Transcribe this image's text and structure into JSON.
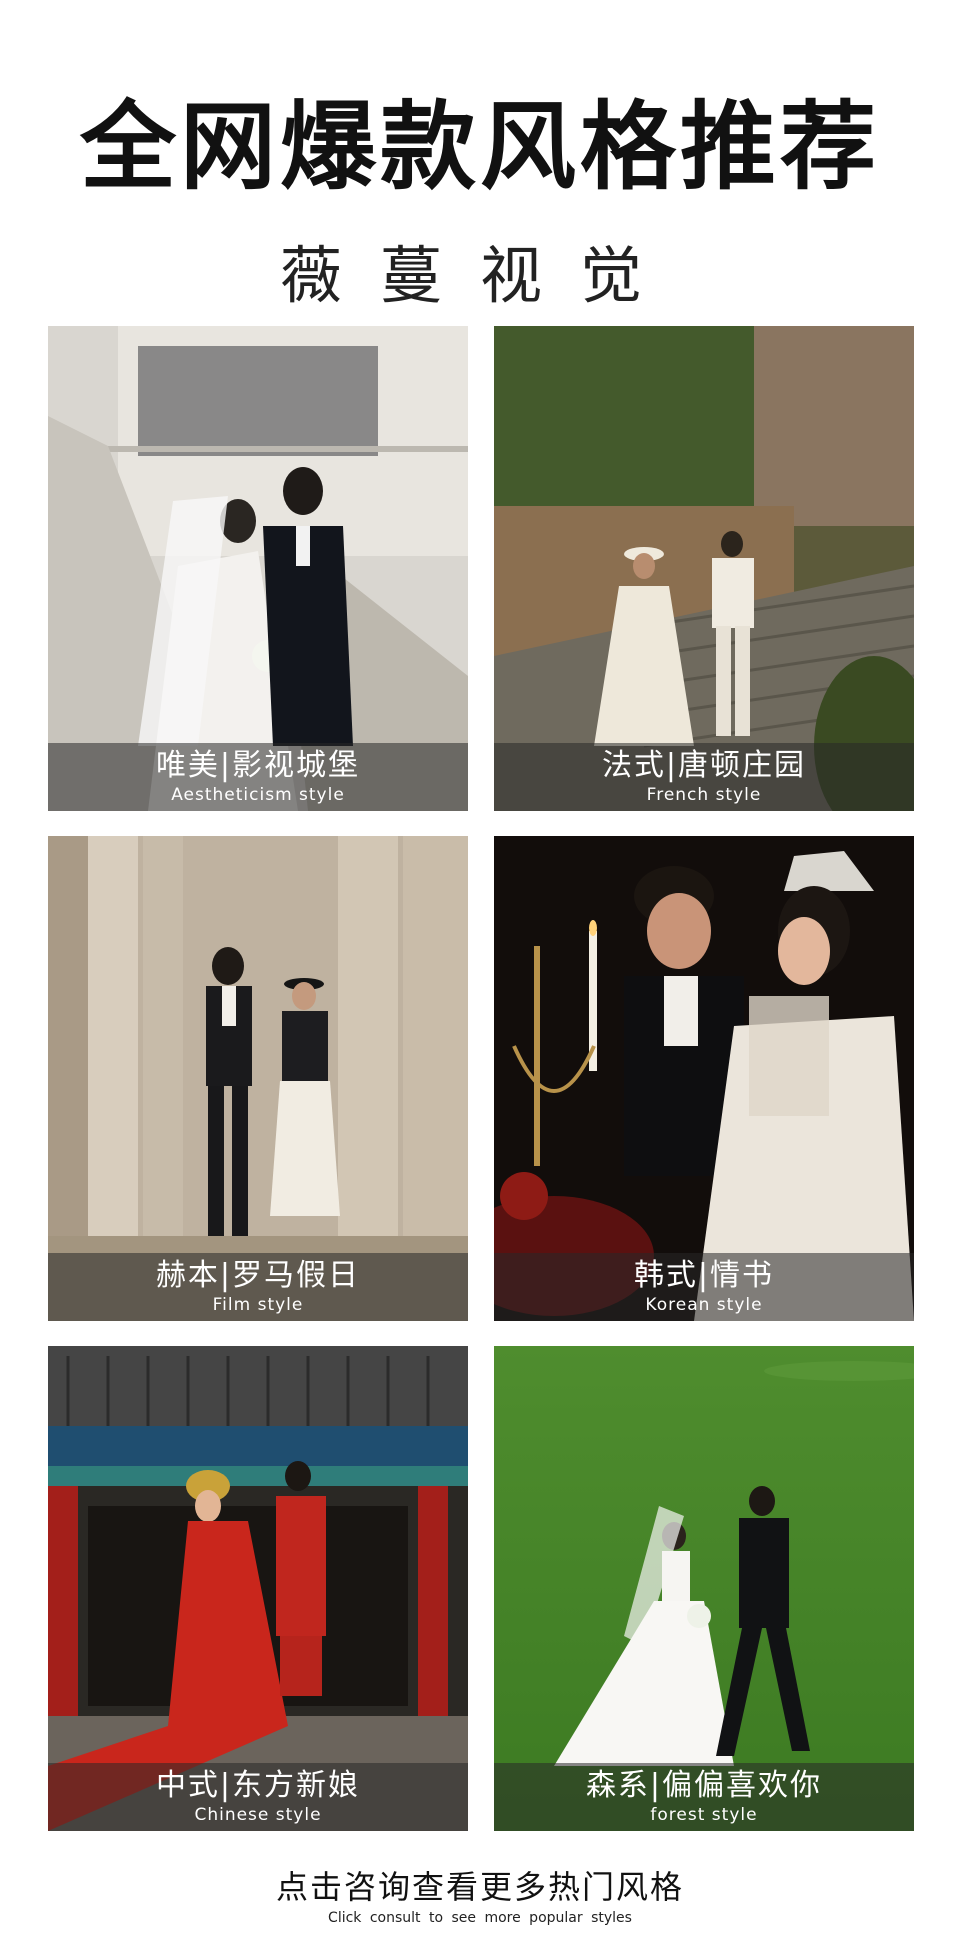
{
  "header": {
    "title": "全网爆款风格推荐",
    "subtitle": "薇蔓视觉"
  },
  "styles": [
    {
      "zh": "唯美|影视城堡",
      "en": "Aestheticism style"
    },
    {
      "zh": "法式|唐顿庄园",
      "en": "French style"
    },
    {
      "zh": "赫本|罗马假日",
      "en": "Film style"
    },
    {
      "zh": "韩式|情书",
      "en": "Korean style"
    },
    {
      "zh": "中式|东方新娘",
      "en": "Chinese style"
    },
    {
      "zh": "森系|偏偏喜欢你",
      "en": "forest style"
    }
  ],
  "footer": {
    "cta": "点击咨询查看更多热门风格",
    "cta_en": "Click consult to see more popular styles"
  }
}
